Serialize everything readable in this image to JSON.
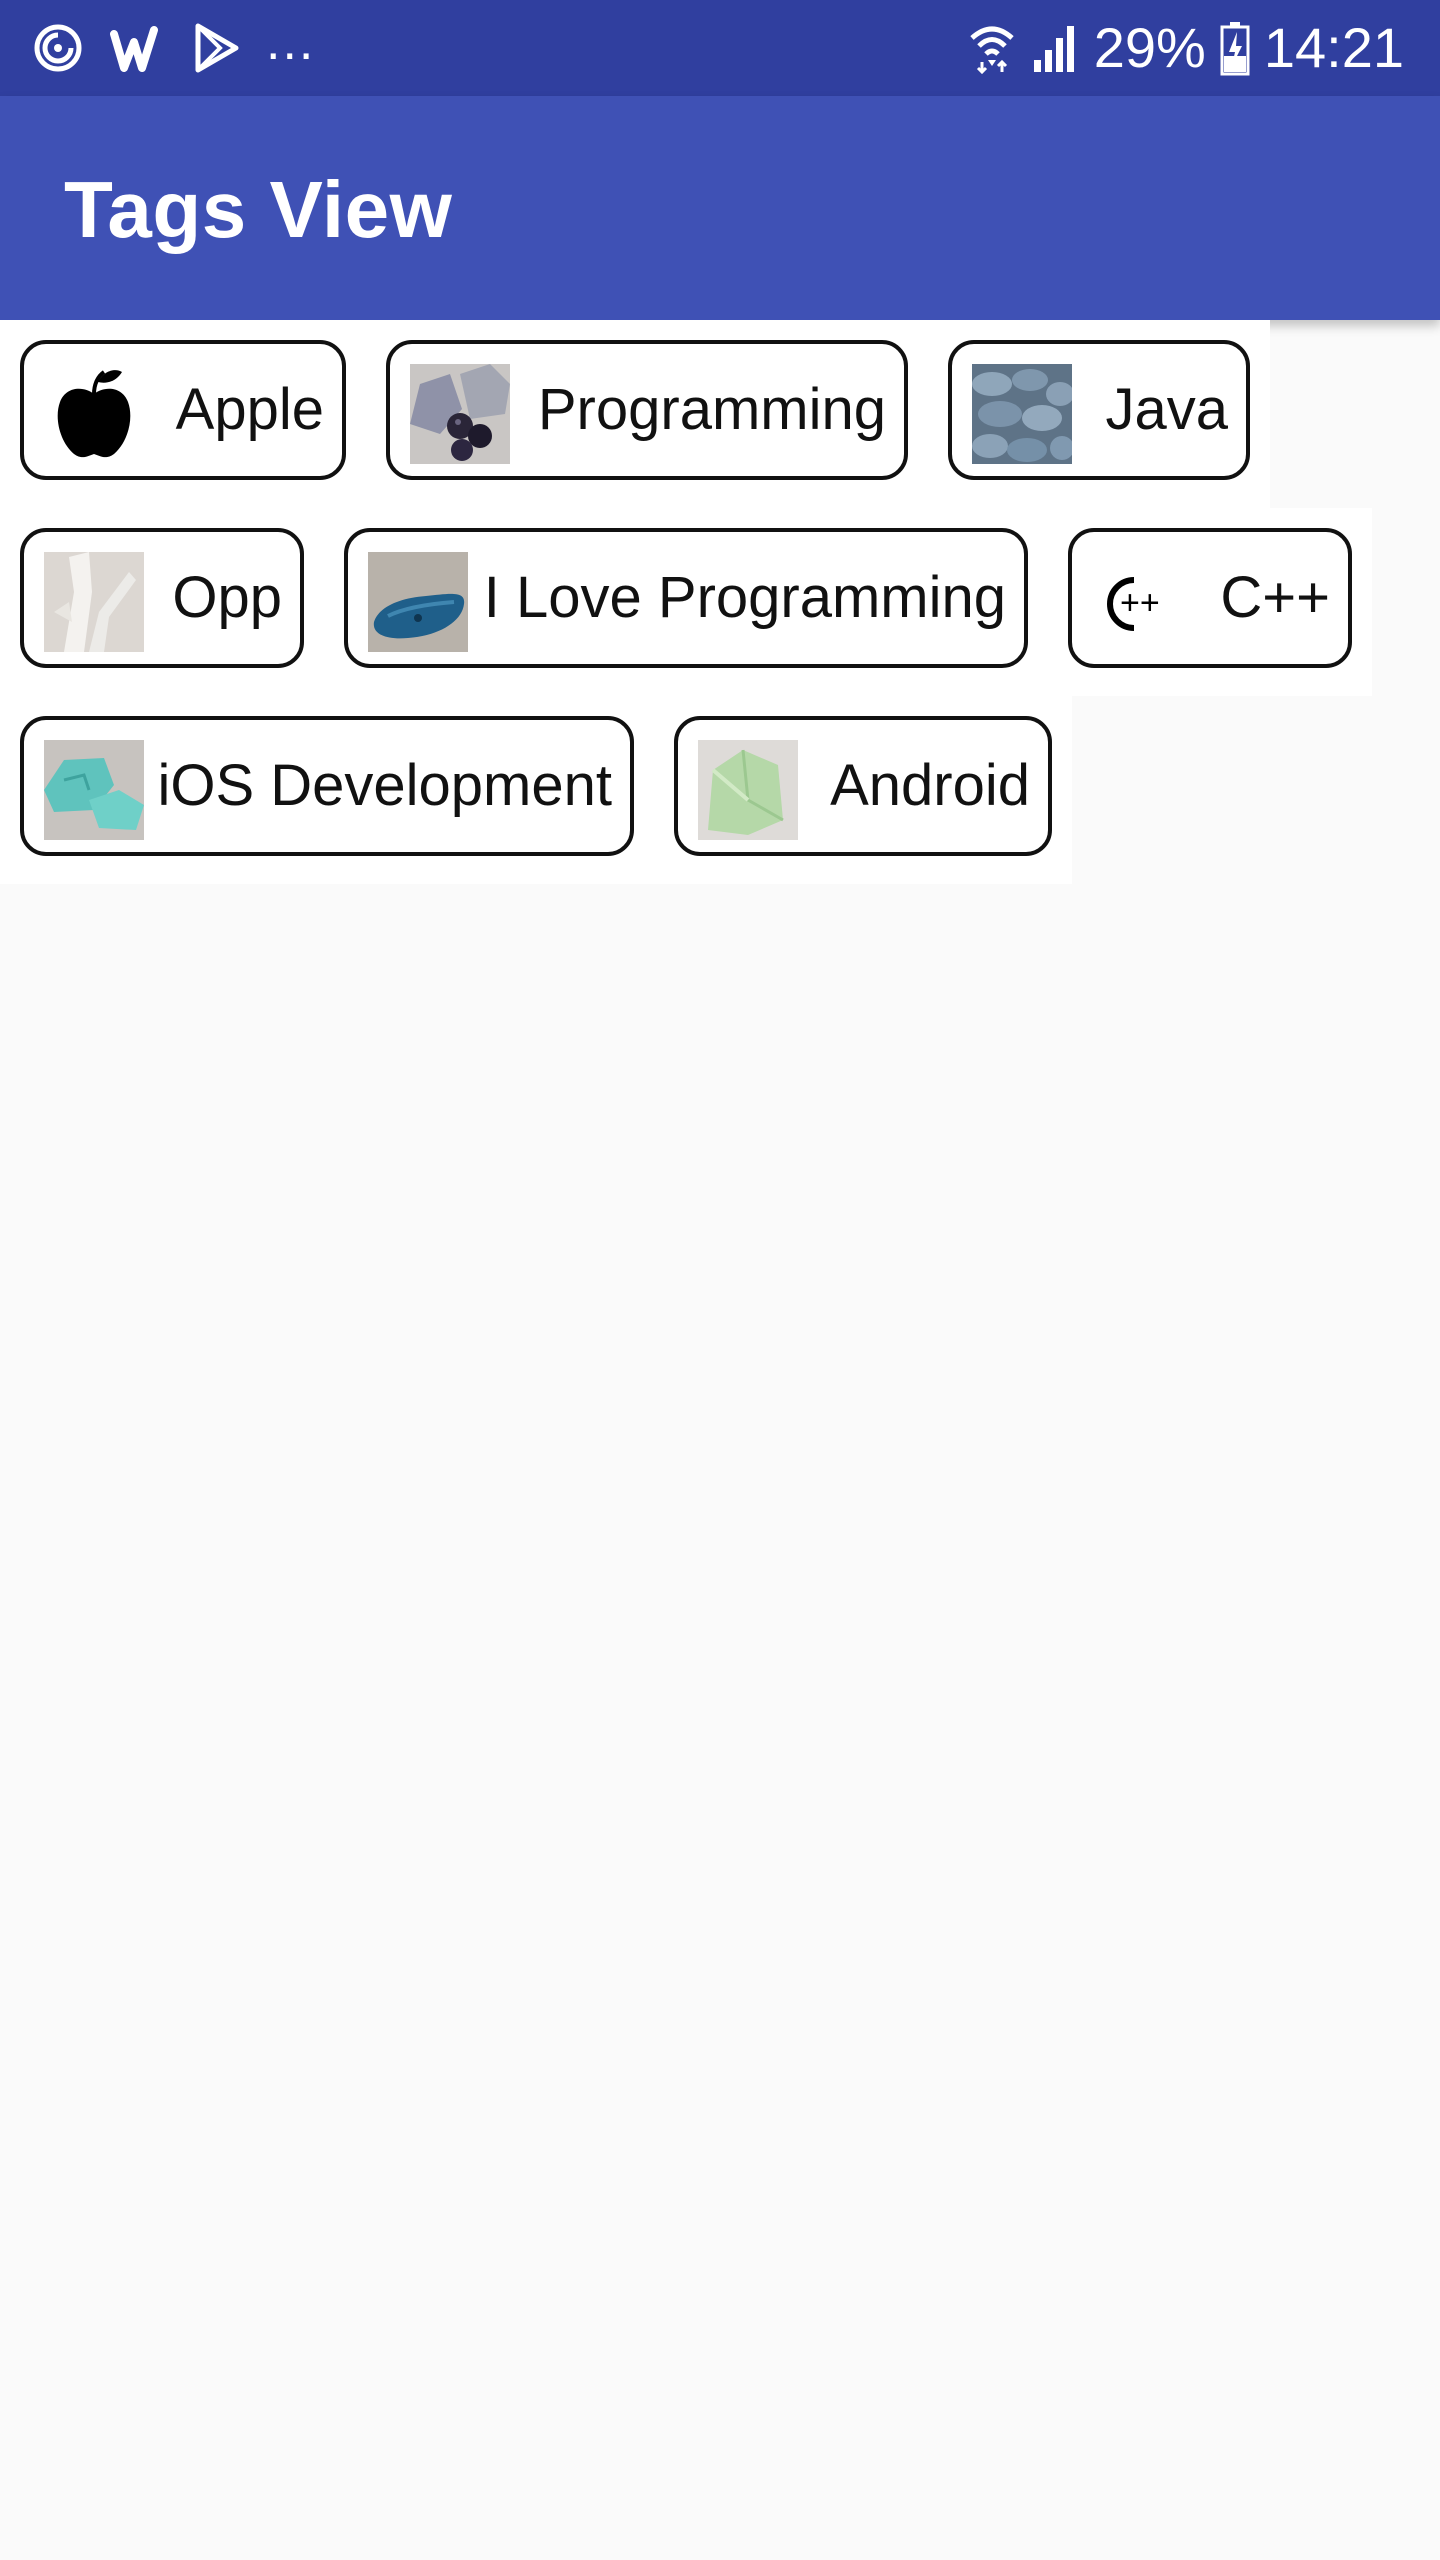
{
  "status_bar": {
    "battery": "29%",
    "time": "14:21",
    "overflow": "...",
    "icons": [
      "sync-icon",
      "w-app-icon",
      "play-store-icon",
      "wifi-icon",
      "signal-icon",
      "battery-charging-icon"
    ]
  },
  "app_bar": {
    "title": "Tags View"
  },
  "tags": [
    {
      "label": "Apple",
      "icon": "apple-icon"
    },
    {
      "label": "Programming",
      "icon": "stones-thumbnail"
    },
    {
      "label": "Java",
      "icon": "blue-pebbles-thumbnail"
    },
    {
      "label": "Opp",
      "icon": "white-crystal-thumbnail"
    },
    {
      "label": "I Love Programming",
      "icon": "blue-stone-thumbnail"
    },
    {
      "label": "C++",
      "icon": "cpp-logo-icon"
    },
    {
      "label": "iOS Development",
      "icon": "turquoise-stone-thumbnail"
    },
    {
      "label": "Android",
      "icon": "green-crystal-thumbnail"
    }
  ],
  "colors": {
    "status_bar": "#303f9f",
    "app_bar": "#3f51b5",
    "background": "#fafafa"
  }
}
